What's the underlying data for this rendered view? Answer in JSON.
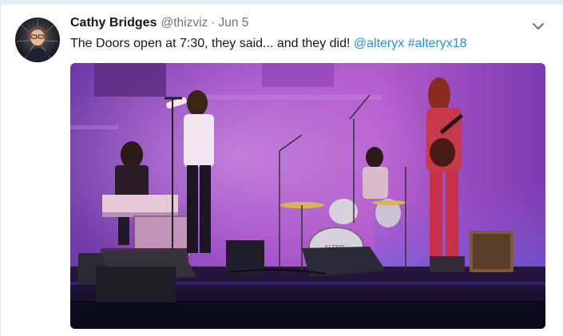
{
  "tweet": {
    "author_name": "Cathy Bridges",
    "author_handle": "@thizviz",
    "separator": "·",
    "date": "Jun 5",
    "text_plain": "The Doors open at 7:30, they said... and they did! ",
    "mentions": [
      "@alteryx",
      "#alteryx18"
    ]
  },
  "icons": {
    "avatar": "avatar-image",
    "caret": "chevron-down-icon"
  },
  "colors": {
    "link": "#1b95e0",
    "secondary_text": "#657786",
    "stage_purple": "#8a3fb0"
  }
}
